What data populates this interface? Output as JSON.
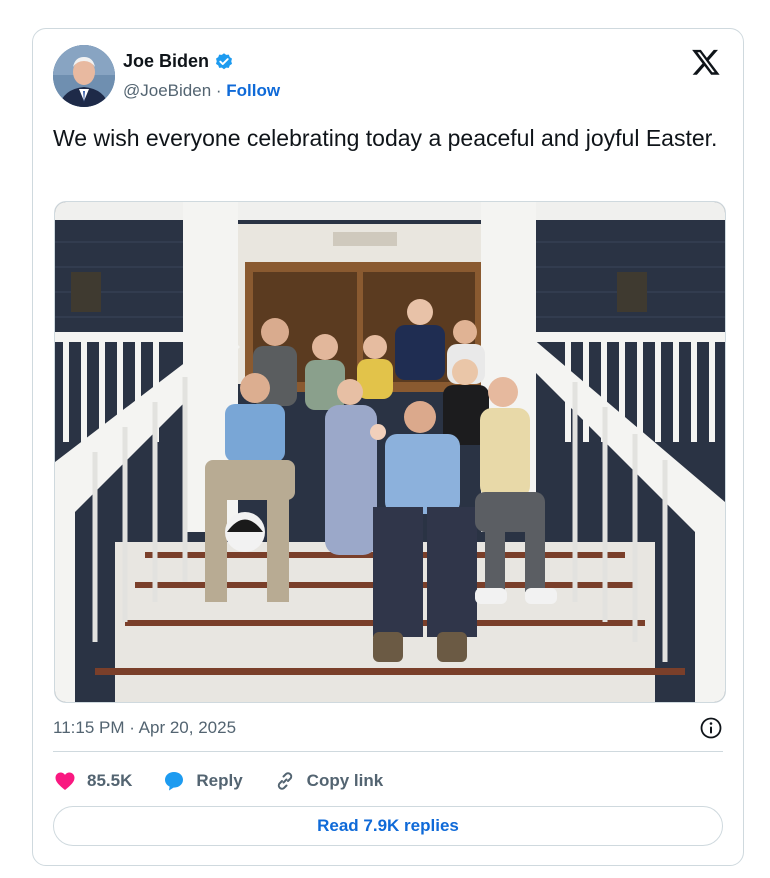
{
  "author": {
    "name": "Joe Biden",
    "handle": "@JoeBiden",
    "separator": " · ",
    "follow_label": "Follow",
    "verified_color": "#1d9bf0"
  },
  "tweet": {
    "text": "We wish everyone celebrating today a peaceful and joyful Easter.",
    "timestamp": "11:15 PM · Apr 20, 2025",
    "media_description": "Family photo on white porch steps"
  },
  "actions": {
    "likes": "85.5K",
    "reply_label": "Reply",
    "copy_link_label": "Copy link",
    "read_replies_label": "Read 7.9K replies"
  },
  "icons": {
    "like": "heart-icon",
    "reply": "speech-bubble-icon",
    "copy": "link-icon",
    "info": "info-icon",
    "platform": "x-logo-icon"
  },
  "colors": {
    "heart": "#f91880",
    "bubble": "#1d9bf0",
    "link_blue": "#0f6ad8"
  }
}
